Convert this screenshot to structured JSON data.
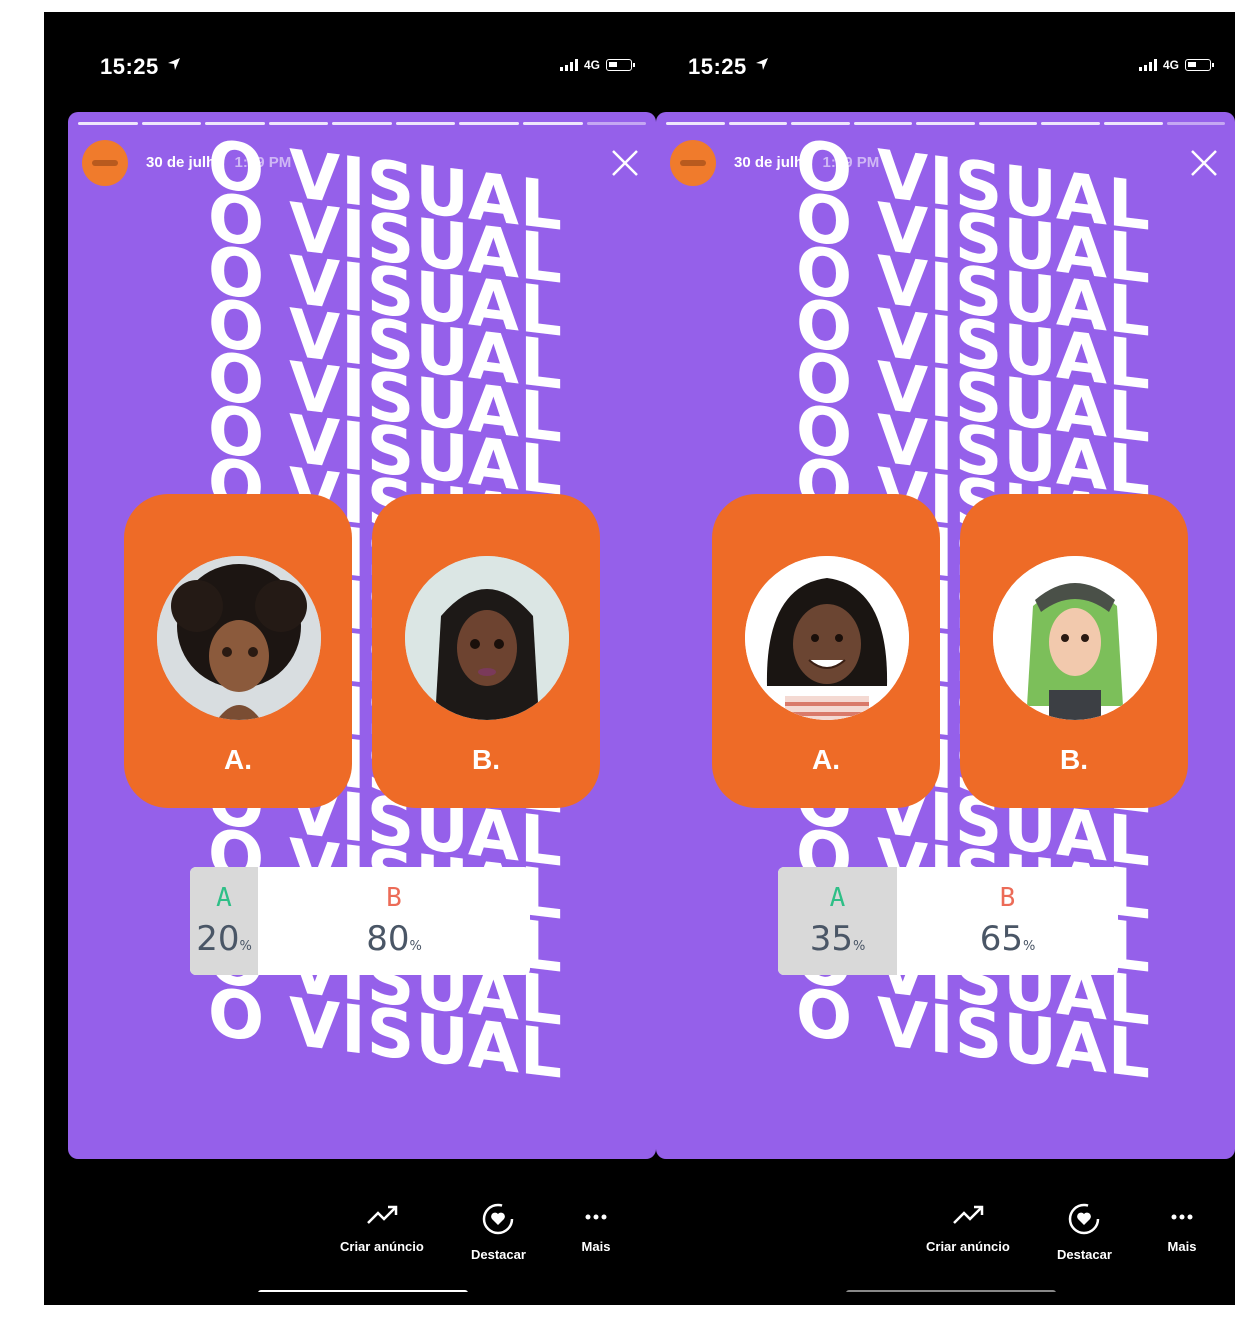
{
  "screens": [
    {
      "status": {
        "time": "15:25",
        "network": "4G"
      },
      "header": {
        "date": "30 de julho",
        "time_partial": "1:19 PM"
      },
      "background_word": "O VISUAL",
      "options": [
        {
          "letter": "A."
        },
        {
          "letter": "B."
        }
      ],
      "results": {
        "a_label": "A",
        "a_value": "20",
        "a_unit": "%",
        "b_label": "B",
        "b_value": "80",
        "b_unit": "%",
        "a_fraction": 0.2
      },
      "actions": [
        {
          "label": "Criar anúncio",
          "icon": "trend-up-icon"
        },
        {
          "label": "Destacar",
          "icon": "heart-circle-icon"
        },
        {
          "label": "Mais",
          "icon": "more-icon"
        }
      ]
    },
    {
      "status": {
        "time": "15:25",
        "network": "4G"
      },
      "header": {
        "date": "30 de julho",
        "time_partial": "1:19 PM"
      },
      "background_word": "O VISUAL",
      "options": [
        {
          "letter": "A."
        },
        {
          "letter": "B."
        }
      ],
      "results": {
        "a_label": "A",
        "a_value": "35",
        "a_unit": "%",
        "b_label": "B",
        "b_value": "65",
        "b_unit": "%",
        "a_fraction": 0.35
      },
      "actions": [
        {
          "label": "Criar anúncio",
          "icon": "trend-up-icon"
        },
        {
          "label": "Destacar",
          "icon": "heart-circle-icon"
        },
        {
          "label": "Mais",
          "icon": "more-icon"
        }
      ]
    }
  ],
  "colors": {
    "story_bg": "#9560ea",
    "card": "#ee6b27",
    "accent_a": "#2fbf87",
    "accent_b": "#ec6b57"
  }
}
